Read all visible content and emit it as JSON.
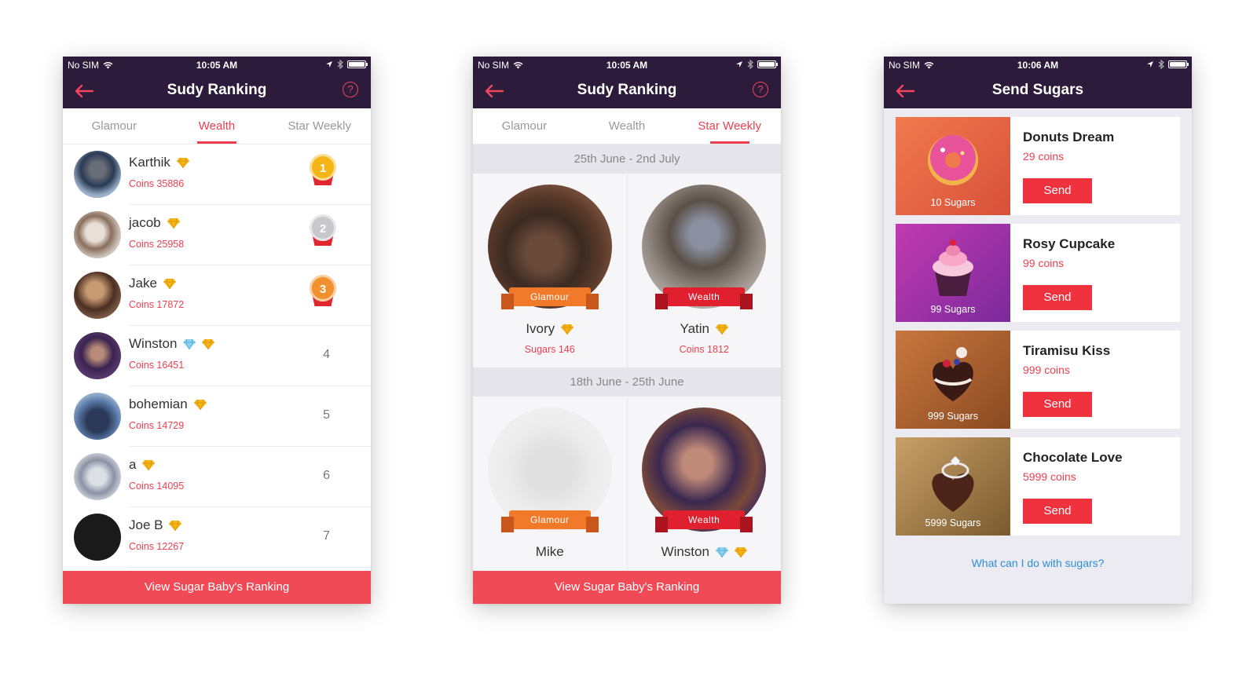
{
  "status_bars": [
    {
      "carrier": "No SIM",
      "time": "10:05 AM"
    },
    {
      "carrier": "No SIM",
      "time": "10:05 AM"
    },
    {
      "carrier": "No SIM",
      "time": "10:06 AM"
    }
  ],
  "screen1": {
    "title": "Sudy Ranking",
    "help_label": "?",
    "tabs": [
      "Glamour",
      "Wealth",
      "Star Weekly"
    ],
    "active_tab": "Wealth",
    "rows": [
      {
        "name": "Karthik",
        "coins": "Coins 35886",
        "rank": "1",
        "medal": "gold",
        "diamond": false
      },
      {
        "name": "jacob",
        "coins": "Coins 25958",
        "rank": "2",
        "medal": "silver",
        "diamond": false
      },
      {
        "name": "Jake",
        "coins": "Coins 17872",
        "rank": "3",
        "medal": "bronze",
        "diamond": false
      },
      {
        "name": "Winston",
        "coins": "Coins 16451",
        "rank": "4",
        "medal": "",
        "diamond": true
      },
      {
        "name": "bohemian",
        "coins": "Coins 14729",
        "rank": "5",
        "medal": "",
        "diamond": false
      },
      {
        "name": "a",
        "coins": "Coins 14095",
        "rank": "6",
        "medal": "",
        "diamond": false
      },
      {
        "name": "Joe B",
        "coins": "Coins 12267",
        "rank": "7",
        "medal": "",
        "diamond": false
      }
    ],
    "bottom_button": "View Sugar Baby's Ranking"
  },
  "screen2": {
    "title": "Sudy Ranking",
    "help_label": "?",
    "tabs": [
      "Glamour",
      "Wealth",
      "Star Weekly"
    ],
    "active_tab": "Star Weekly",
    "weeks": [
      {
        "range": "25th June - 2nd July",
        "cells": [
          {
            "banner": "Glamour",
            "name": "Ivory",
            "value": "Sugars 146",
            "diamond": false
          },
          {
            "banner": "Wealth",
            "name": "Yatin",
            "value": "Coins 1812",
            "diamond": false
          }
        ]
      },
      {
        "range": "18th June - 25th June",
        "cells": [
          {
            "banner": "Glamour",
            "name": "Mike",
            "value": "",
            "diamond": false
          },
          {
            "banner": "Wealth",
            "name": "Winston",
            "value": "",
            "diamond": true
          }
        ]
      }
    ],
    "bottom_button": "View Sugar Baby's Ranking"
  },
  "screen3": {
    "title": "Send Sugars",
    "gifts": [
      {
        "name": "Donuts Dream",
        "price": "29 coins",
        "sugars": "10 Sugars",
        "send": "Send",
        "icon": "donut-icon"
      },
      {
        "name": "Rosy Cupcake",
        "price": "99 coins",
        "sugars": "99 Sugars",
        "send": "Send",
        "icon": "cupcake-icon"
      },
      {
        "name": "Tiramisu Kiss",
        "price": "999 coins",
        "sugars": "999 Sugars",
        "send": "Send",
        "icon": "cake-icon"
      },
      {
        "name": "Chocolate Love",
        "price": "5999 coins",
        "sugars": "5999 Sugars",
        "send": "Send",
        "icon": "ring-heart-icon"
      }
    ],
    "link": "What can I do with sugars?"
  },
  "colors": {
    "nav": "#2c1b3b",
    "accent": "#ee3f4f",
    "link": "#2f8fd6"
  }
}
